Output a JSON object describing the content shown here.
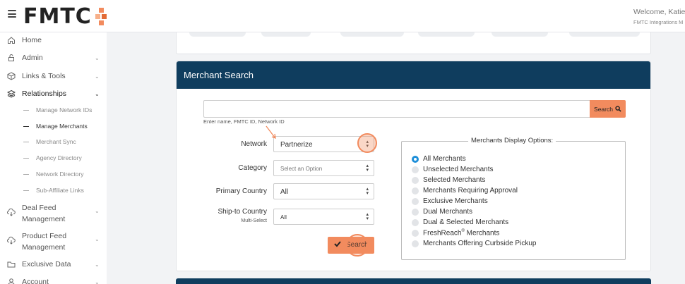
{
  "header": {
    "logo_text": "FMTC",
    "welcome": "Welcome, Katie A",
    "welcome_sub": "FMTC Integrations M"
  },
  "sidebar": {
    "items": [
      {
        "label": "Home",
        "icon": "home-icon"
      },
      {
        "label": "Admin",
        "icon": "lock-icon"
      },
      {
        "label": "Links & Tools",
        "icon": "box-icon"
      },
      {
        "label": "Relationships",
        "icon": "layers-icon"
      }
    ],
    "sub_items": [
      "Manage Network IDs",
      "Manage Merchants",
      "Merchant Sync",
      "Agency Directory",
      "Network Directory",
      "Sub-Affiliate Links"
    ],
    "lower_items": [
      {
        "line1": "Deal Feed",
        "line2": "Management",
        "icon": "cloud-download-icon"
      },
      {
        "line1": "Product Feed",
        "line2": "Management",
        "icon": "cloud-download-icon"
      }
    ],
    "bottom_items": [
      {
        "label": "Exclusive Data",
        "icon": "folder-icon"
      },
      {
        "label": "Account",
        "icon": "user-icon"
      }
    ]
  },
  "merchant_search": {
    "title": "Merchant Search",
    "search_value": "",
    "search_button": "Search",
    "helper": "Enter name, FMTC ID, Network ID",
    "network_label": "Network",
    "network_value": "Partnerize",
    "category_label": "Category",
    "category_placeholder": "Select an Option",
    "country_label": "Primary Country",
    "country_value": "All",
    "ship_label": "Ship-to Country",
    "ship_sub": "Multi-Select",
    "ship_value": "All",
    "submit_label": "Search"
  },
  "display_options": {
    "title": "Merchants Display Options:",
    "options": [
      "All Merchants",
      "Unselected Merchants",
      "Selected Merchants",
      "Merchants Requiring Approval",
      "Exclusive Merchants",
      "Dual Merchants",
      "Dual & Selected Merchants",
      "FreshReach",
      "Merchants Offering Curbside Pickup"
    ],
    "freshreach_suffix": " Merchants",
    "selected_index": 0
  },
  "colors": {
    "header_bg": "#0f3d5e",
    "accent": "#f28b5e",
    "radio_on": "#1e8fd9"
  }
}
